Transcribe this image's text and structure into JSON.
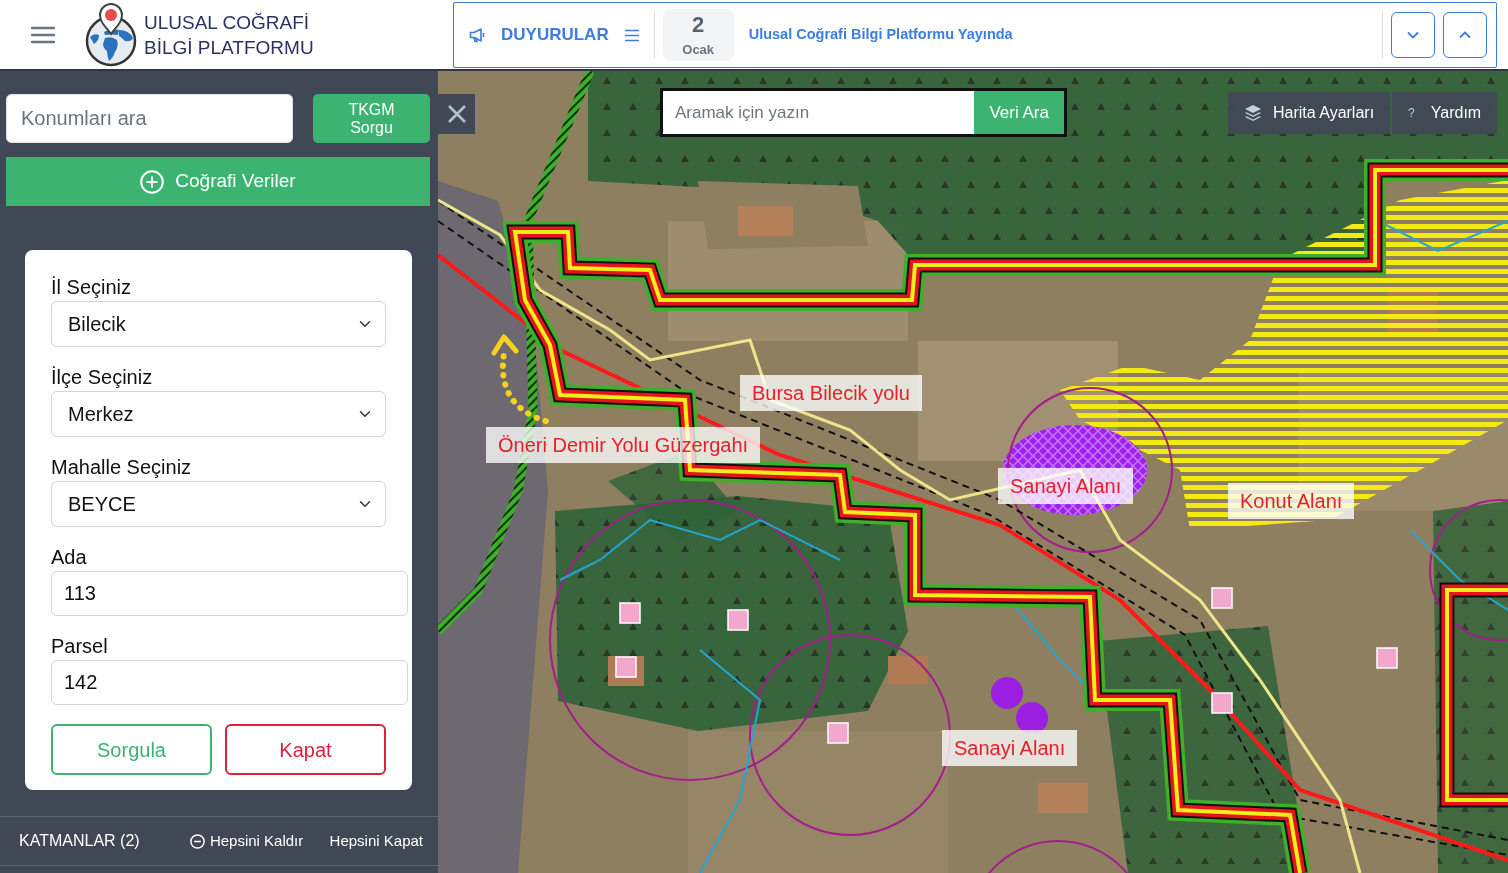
{
  "header": {
    "title_lines": [
      "ULUSAL COĞRAFİ",
      "BİLGİ PLATFORMU"
    ]
  },
  "announcements": {
    "label": "DUYURULAR",
    "date": {
      "day": "2",
      "month": "Ocak"
    },
    "headline": "Ulusal Coğrafi Bilgi Platformu Yayında"
  },
  "sidebar": {
    "search": {
      "placeholder": "Konumları ara"
    },
    "query_button": "TKGM Sorgu",
    "data_button": "Coğrafi Veriler",
    "form": {
      "fields": [
        {
          "kind": "select",
          "label": "İl Seçiniz",
          "value": "Bilecik"
        },
        {
          "kind": "select",
          "label": "İlçe Seçiniz",
          "value": "Merkez"
        },
        {
          "kind": "select",
          "label": "Mahalle Seçiniz",
          "value": "BEYCE"
        },
        {
          "kind": "input",
          "label": "Ada",
          "value": "113"
        },
        {
          "kind": "input",
          "label": "Parsel",
          "value": "142"
        }
      ],
      "buttons": [
        {
          "kind": "submit",
          "label": "Sorgula"
        },
        {
          "kind": "cancel",
          "label": "Kapat"
        }
      ]
    },
    "layers_bar": {
      "title": "KATMANLAR (2)",
      "remove_all": "Hepsini Kaldır",
      "close_all": "Hepsini Kapat"
    }
  },
  "map": {
    "search": {
      "placeholder": "Aramak için yazın",
      "button": "Veri Ara"
    },
    "tools": [
      {
        "kind": "settings",
        "label": "Harita Ayarları"
      },
      {
        "kind": "help",
        "icon": "?",
        "label": "Yardım"
      }
    ],
    "labels": [
      "Bursa Bilecik yolu",
      "Öneri Demir Yolu Güzergahı",
      "Sanayi Alanı",
      "Konut Alanı",
      "Sanayi Alanı"
    ]
  }
}
